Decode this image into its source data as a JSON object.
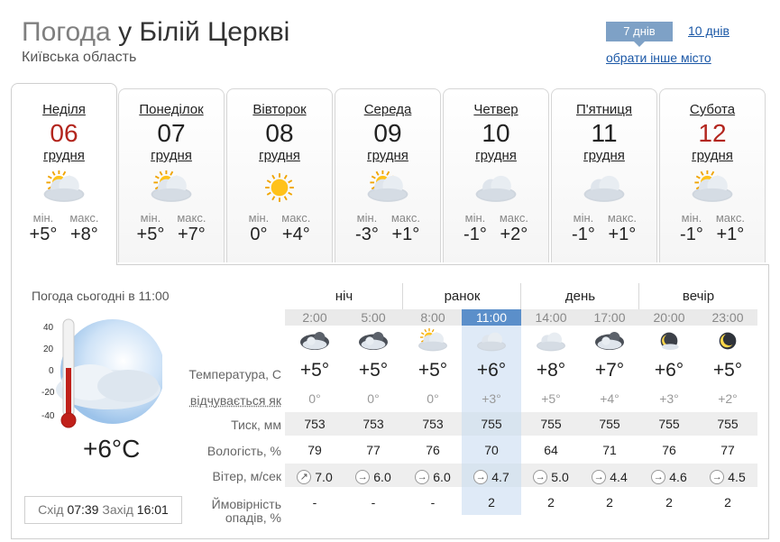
{
  "header": {
    "title_prefix": "Погода",
    "title_city": "у Білій Церкві",
    "region": "Київська область",
    "tab_7": "7 днів",
    "tab_10": "10 днів",
    "other_city": "обрати інше місто"
  },
  "days": [
    {
      "name": "Неділя",
      "num": "06",
      "month": "грудня",
      "min_label": "мін.",
      "max_label": "макс.",
      "min": "+5°",
      "max": "+8°",
      "icon": "partly-cloudy-icon",
      "red": true
    },
    {
      "name": "Понеділок",
      "num": "07",
      "month": "грудня",
      "min_label": "мін.",
      "max_label": "макс.",
      "min": "+5°",
      "max": "+7°",
      "icon": "partly-cloudy-icon",
      "red": false
    },
    {
      "name": "Вівторок",
      "num": "08",
      "month": "грудня",
      "min_label": "мін.",
      "max_label": "макс.",
      "min": "0°",
      "max": "+4°",
      "icon": "sunny-icon",
      "red": false
    },
    {
      "name": "Середа",
      "num": "09",
      "month": "грудня",
      "min_label": "мін.",
      "max_label": "макс.",
      "min": "-3°",
      "max": "+1°",
      "icon": "partly-cloudy-icon",
      "red": false
    },
    {
      "name": "Четвер",
      "num": "10",
      "month": "грудня",
      "min_label": "мін.",
      "max_label": "макс.",
      "min": "-1°",
      "max": "+2°",
      "icon": "cloudy-icon",
      "red": false
    },
    {
      "name": "П'ятниця",
      "num": "11",
      "month": "грудня",
      "min_label": "мін.",
      "max_label": "макс.",
      "min": "-1°",
      "max": "+1°",
      "icon": "cloudy-icon",
      "red": false
    },
    {
      "name": "Субота",
      "num": "12",
      "month": "грудня",
      "min_label": "мін.",
      "max_label": "макс.",
      "min": "-1°",
      "max": "+1°",
      "icon": "partly-cloudy-icon",
      "red": true
    }
  ],
  "today": {
    "title": "Погода сьогодні в 11:00",
    "temp": "+6°C",
    "scale": [
      "40",
      "20",
      "0",
      "-20",
      "-40"
    ],
    "sunrise_label": "Схід",
    "sunrise": "07:39",
    "sunset_label": "Захід",
    "sunset": "16:01"
  },
  "periods": [
    "ніч",
    "ранок",
    "день",
    "вечір"
  ],
  "rows": {
    "temp_label": "Температура, С",
    "feel_label": "відчувається як",
    "pressure_label": "Тиск, мм",
    "humidity_label": "Вологість, %",
    "wind_label": "Вітер, м/сек",
    "precip_label_1": "Ймовірність",
    "precip_label_2": "опадів, %"
  },
  "hours": [
    {
      "time": "2:00",
      "temp": "+5°",
      "feel": "0°",
      "pressure": "753",
      "humidity": "79",
      "wind_dir": "↗",
      "wind": "7.0",
      "precip": "-",
      "icon": "cloudy-night-icon"
    },
    {
      "time": "5:00",
      "temp": "+5°",
      "feel": "0°",
      "pressure": "753",
      "humidity": "77",
      "wind_dir": "→",
      "wind": "6.0",
      "precip": "-",
      "icon": "cloudy-night-icon"
    },
    {
      "time": "8:00",
      "temp": "+5°",
      "feel": "0°",
      "pressure": "753",
      "humidity": "76",
      "wind_dir": "→",
      "wind": "6.0",
      "precip": "-",
      "icon": "partly-cloudy-icon"
    },
    {
      "time": "11:00",
      "temp": "+6°",
      "feel": "+3°",
      "pressure": "755",
      "humidity": "70",
      "wind_dir": "→",
      "wind": "4.7",
      "precip": "2",
      "icon": "cloud-icon"
    },
    {
      "time": "14:00",
      "temp": "+8°",
      "feel": "+5°",
      "pressure": "755",
      "humidity": "64",
      "wind_dir": "→",
      "wind": "5.0",
      "precip": "2",
      "icon": "cloud-icon"
    },
    {
      "time": "17:00",
      "temp": "+7°",
      "feel": "+4°",
      "pressure": "755",
      "humidity": "71",
      "wind_dir": "→",
      "wind": "4.4",
      "precip": "2",
      "icon": "cloudy-night-icon"
    },
    {
      "time": "20:00",
      "temp": "+6°",
      "feel": "+3°",
      "pressure": "755",
      "humidity": "76",
      "wind_dir": "→",
      "wind": "4.6",
      "precip": "2",
      "icon": "moon-cloud-icon"
    },
    {
      "time": "23:00",
      "temp": "+5°",
      "feel": "+2°",
      "pressure": "755",
      "humidity": "77",
      "wind_dir": "→",
      "wind": "4.5",
      "precip": "2",
      "icon": "moon-icon"
    }
  ],
  "colors": {
    "accent": "#7ea1c6",
    "link": "#1a57a6",
    "red_day": "#b3261e",
    "current_col": "#dfeaf7"
  }
}
